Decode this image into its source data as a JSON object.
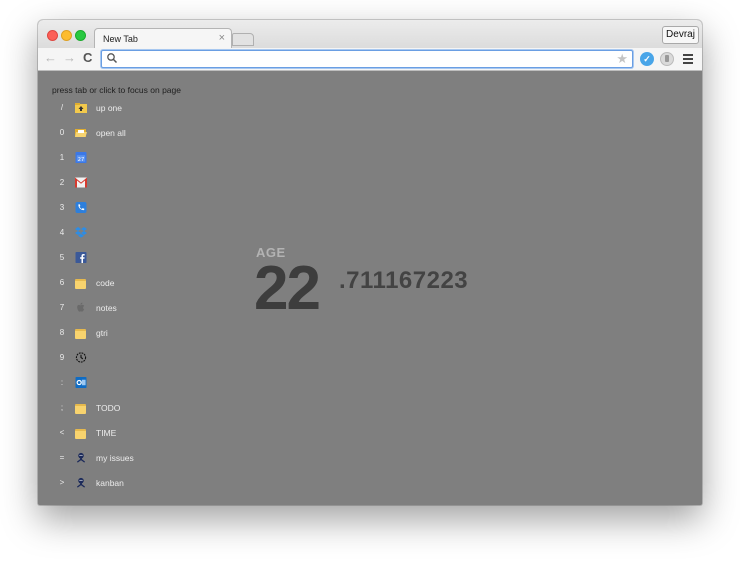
{
  "window": {
    "tab_title": "New Tab",
    "tab_close": "×",
    "profile_name": "Devraj"
  },
  "toolbar": {
    "back": "←",
    "forward": "→",
    "reload": "C",
    "star": "★",
    "search_placeholder": "",
    "extensions": [
      "blue-circle-extension-icon",
      "gray-toggle-extension-icon"
    ],
    "menu_icon": "hamburger-menu-icon"
  },
  "page": {
    "hint": "press tab or click to focus on page",
    "bookmarks": [
      {
        "key": "/",
        "icon": "folder-up-icon",
        "label": "up one"
      },
      {
        "key": "0",
        "icon": "folder-open-icon",
        "label": "open all"
      },
      {
        "key": "1",
        "icon": "calendar-icon",
        "label": ""
      },
      {
        "key": "2",
        "icon": "gmail-icon",
        "label": ""
      },
      {
        "key": "3",
        "icon": "phone-icon",
        "label": ""
      },
      {
        "key": "4",
        "icon": "dropbox-icon",
        "label": ""
      },
      {
        "key": "5",
        "icon": "facebook-icon",
        "label": ""
      },
      {
        "key": "6",
        "icon": "folder-icon",
        "label": "code"
      },
      {
        "key": "7",
        "icon": "apple-icon",
        "label": "notes"
      },
      {
        "key": "8",
        "icon": "folder-icon",
        "label": "gtri"
      },
      {
        "key": "9",
        "icon": "clock-icon",
        "label": ""
      },
      {
        "key": ":",
        "icon": "outlook-icon",
        "label": ""
      },
      {
        "key": ";",
        "icon": "folder-icon",
        "label": "TODO"
      },
      {
        "key": "<",
        "icon": "folder-icon",
        "label": "TIME"
      },
      {
        "key": "=",
        "icon": "github-octocat-icon",
        "label": "my issues"
      },
      {
        "key": ">",
        "icon": "github-octocat-icon",
        "label": "kanban"
      }
    ],
    "age": {
      "label": "AGE",
      "integer": "22",
      "decimal": ".711167223"
    }
  },
  "colors": {
    "page_background": "#7f7f7f",
    "age_text": "#3d3d3d",
    "bookmark_text": "#ececec"
  }
}
